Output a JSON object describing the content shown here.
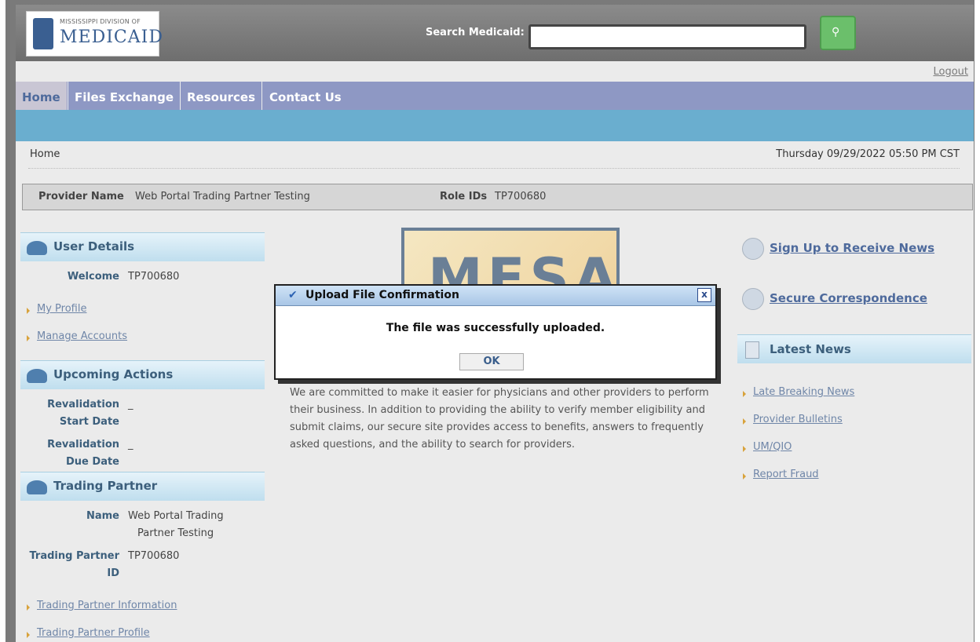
{
  "header": {
    "logo_line1": "MISSISSIPPI DIVISION OF",
    "logo_line2": "MEDICAID",
    "search_label": "Search Medicaid:",
    "search_value": "",
    "search_icon": "search-icon"
  },
  "logout": "Logout",
  "nav": {
    "items": [
      {
        "label": "Home",
        "active": true
      },
      {
        "label": "Files Exchange"
      },
      {
        "label": "Resources"
      },
      {
        "label": "Contact Us"
      }
    ]
  },
  "breadcrumb": "Home",
  "datetime": "Thursday 09/29/2022 05:50 PM CST",
  "provider_bar": {
    "provider_label": "Provider Name",
    "provider_value": "Web Portal Trading Partner Testing",
    "role_label": "Role IDs",
    "role_value": "TP700680"
  },
  "user_details": {
    "title": "User Details",
    "welcome_label": "Welcome",
    "welcome_value": "TP700680",
    "links": [
      "My Profile",
      "Manage Accounts"
    ]
  },
  "upcoming": {
    "title": "Upcoming Actions",
    "start_label1": "Revalidation",
    "start_label2": "Start Date",
    "start_value": "_",
    "due_label1": "Revalidation",
    "due_label2": "Due Date",
    "due_value": "_"
  },
  "trading": {
    "title": "Trading Partner",
    "name_label": "Name",
    "name_value_1": "Web Portal Trading",
    "name_value_2": "Partner Testing",
    "id_label1": "Trading Partner",
    "id_label2": "ID",
    "id_value": "TP700680",
    "links": [
      "Trading Partner Information",
      "Trading Partner Profile"
    ]
  },
  "center": {
    "logo_text": "MESA",
    "intro": "We are committed to make it easier for physicians and other providers to perform their business. In addition to providing the ability to verify member eligibility and submit claims, our secure site provides access to benefits, answers to frequently asked questions, and the ability to search for providers."
  },
  "right": {
    "signup": "Sign Up to Receive News",
    "secure": "Secure Correspondence",
    "news_title": "Latest News",
    "news_links": [
      "Late Breaking News",
      "Provider Bulletins",
      "UM/QIO",
      "Report Fraud"
    ]
  },
  "dialog": {
    "title": "Upload File Confirmation",
    "close": "x",
    "message": "The file was successfully uploaded.",
    "ok": "OK"
  },
  "colors": {
    "nav": "#8e98c4",
    "subnav": "#6aaecf",
    "heading": "#3c5f7c",
    "link": "#6f86a8",
    "search_button": "#6bbf6b"
  }
}
